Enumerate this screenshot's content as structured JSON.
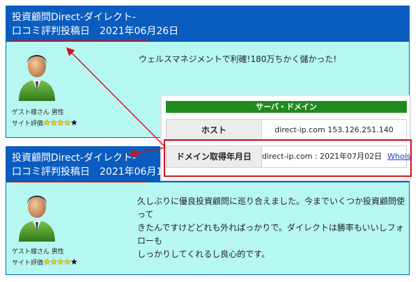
{
  "reviews": [
    {
      "header_line1": "投資顧問Direct-ダイレクト-",
      "header_line2": "口コミ評判投稿日　2021年06月26日",
      "body_lines": [
        "ウェルスマネジメントで利確!180万ちかく儲かった!"
      ],
      "user": "ゲスト様さん 男性",
      "rating_label": "サイト評価",
      "rating_value": "4 of 5",
      "rating_stars": "★★★★",
      "rating_empty_star": "★"
    },
    {
      "header_line1": "投資顧問Direct-ダイレクト-",
      "header_line2": "口コミ評判投稿日　2021年06月11日",
      "body_lines": [
        "久しぶりに優良投資顧問に巡り合えました。今までいくつか投資顧問使って",
        "きたんですけどどれも外れぱっかりで。ダイレクトは勝率もいいしフォローも",
        "しっかりしてくれるし良心的です。"
      ],
      "user": "ゲスト様さん 男性",
      "rating_label": "サイト評価",
      "rating_value": "4 of 5",
      "rating_stars": "★★★★",
      "rating_empty_star": "★"
    }
  ],
  "server_panel": {
    "title": "サーバ・ドメイン",
    "rows": [
      {
        "label": "ホスト",
        "value": "direct-ip.com 153.126.251.140"
      },
      {
        "label": "ドメイン取得年月日",
        "value": "direct-ip.com : 2021年07月02日",
        "link": "Whois"
      }
    ]
  },
  "colors": {
    "header_blue": "#0a5cbf",
    "card_bg": "#b7f7f1",
    "panel_green": "#218a1f",
    "annotation_red": "#d3141b",
    "star_yellow": "#ffd000"
  },
  "icons": [
    "user-avatar",
    "star-icon",
    "arrow-annotation"
  ]
}
